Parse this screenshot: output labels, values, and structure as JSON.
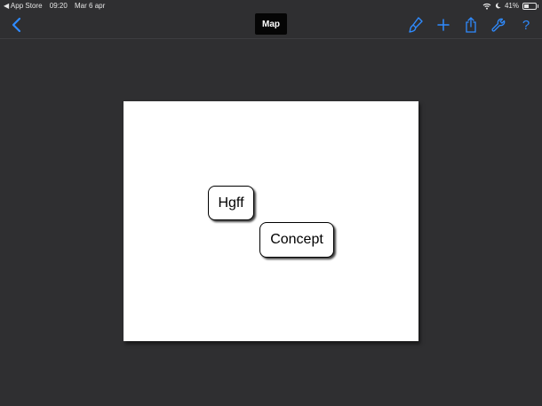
{
  "status_bar": {
    "back_app": "◀ App Store",
    "time": "09:20",
    "date": "Mar 6 apr",
    "battery": "41%",
    "battery_level": 0.41
  },
  "nav": {
    "title": "Map",
    "back_icon": "chevron-left-icon",
    "tools": [
      "brush-icon",
      "plus-icon",
      "share-icon",
      "wrench-icon",
      "help-icon"
    ],
    "help_label": "?"
  },
  "map": {
    "nodes": [
      {
        "label": "Hgff"
      },
      {
        "label": "Concept"
      }
    ]
  },
  "colors": {
    "background": "#2f2f31",
    "accent": "#2f8bff",
    "canvas": "#ffffff"
  }
}
